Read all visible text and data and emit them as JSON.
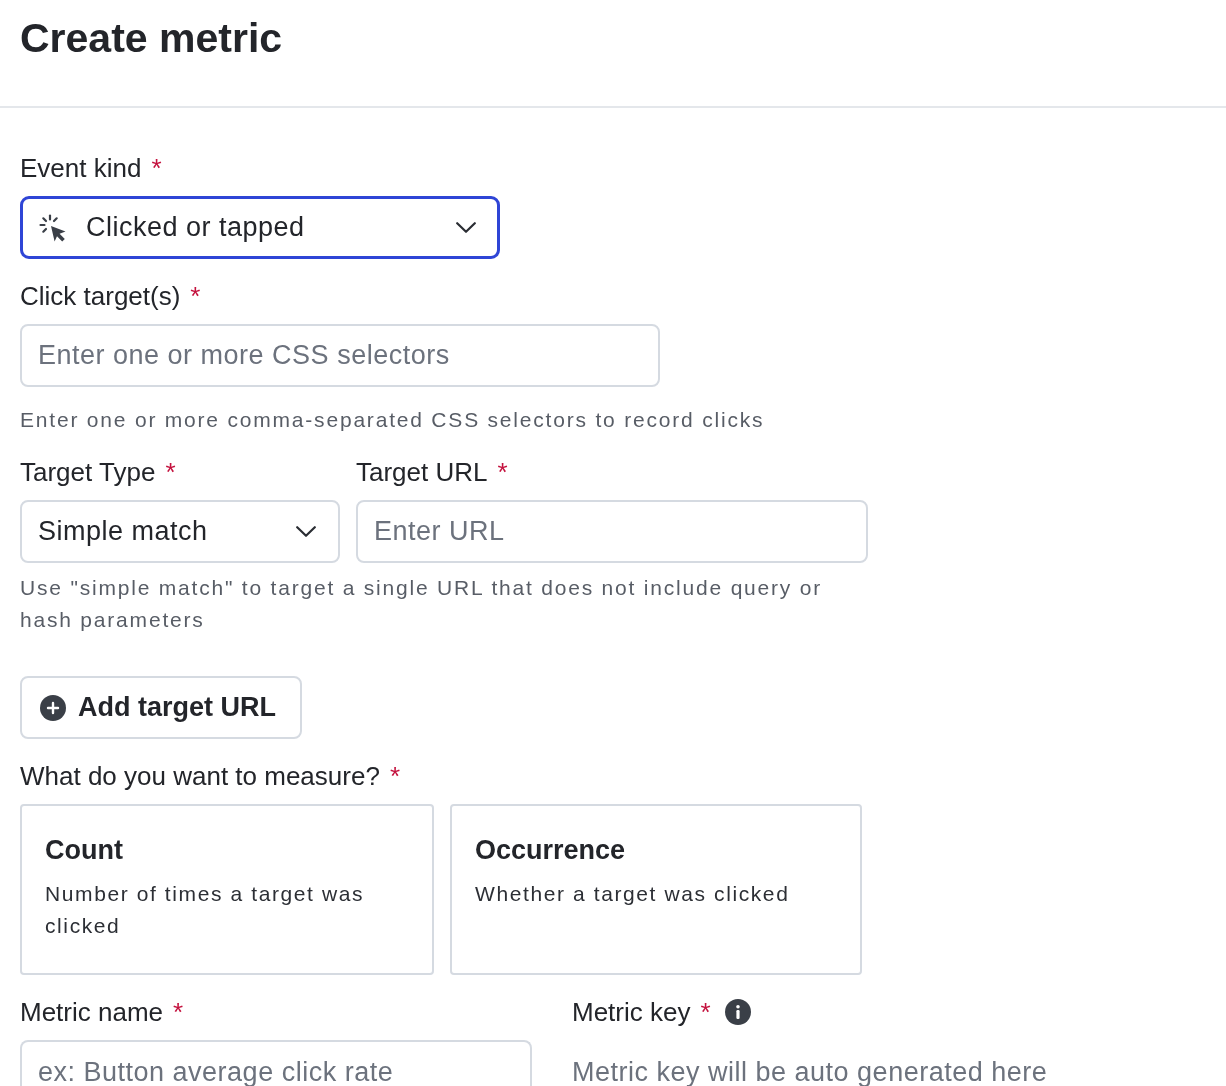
{
  "header": {
    "title": "Create metric"
  },
  "event_kind": {
    "label": "Event kind",
    "required_mark": "*",
    "value": "Clicked or tapped",
    "focused": true
  },
  "click_targets": {
    "label": "Click target(s)",
    "required_mark": "*",
    "placeholder": "Enter one or more CSS selectors",
    "help": "Enter one or more comma-separated CSS selectors to record clicks"
  },
  "target_type": {
    "label": "Target Type",
    "required_mark": "*",
    "value": "Simple match",
    "focused": false
  },
  "target_url": {
    "label": "Target URL",
    "required_mark": "*",
    "placeholder": "Enter URL"
  },
  "target_help": "Use \"simple match\" to target a single URL that does not include query or hash parameters",
  "add_target_button": {
    "label": "Add target URL"
  },
  "measure": {
    "label": "What do you want to measure?",
    "required_mark": "*",
    "options": [
      {
        "title": "Count",
        "description": "Number of times a target was clicked",
        "selected": false
      },
      {
        "title": "Occurrence",
        "description": "Whether a target was clicked",
        "selected": false
      }
    ]
  },
  "metric_name": {
    "label": "Metric name",
    "required_mark": "*",
    "placeholder": "ex: Button average click rate"
  },
  "metric_key": {
    "label": "Metric key",
    "required_mark": "*",
    "hint": "Metric key will be auto generated here"
  }
}
